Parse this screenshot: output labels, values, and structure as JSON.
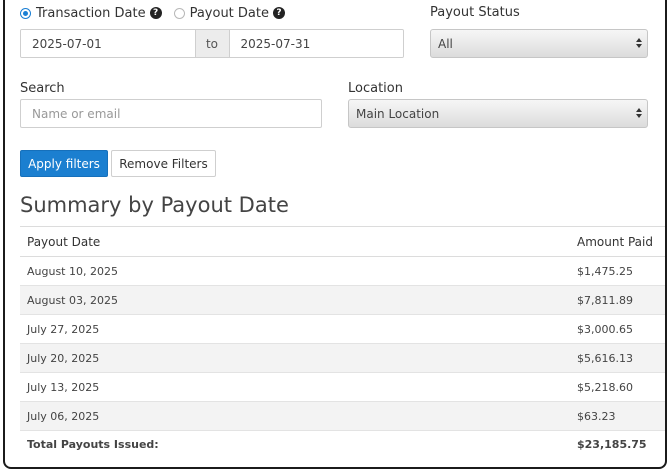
{
  "filters": {
    "date_type_options": [
      {
        "label": "Transaction Date",
        "checked": true
      },
      {
        "label": "Payout Date",
        "checked": false
      }
    ],
    "help_glyph": "?",
    "start_date": "2025-07-01",
    "to_label": "to",
    "end_date": "2025-07-31",
    "payout_status_label": "Payout Status",
    "payout_status_value": "All",
    "search_label": "Search",
    "search_placeholder": "Name or email",
    "location_label": "Location",
    "location_value": "Main Location",
    "apply_label": "Apply filters",
    "remove_label": "Remove Filters"
  },
  "summary": {
    "title": "Summary by Payout Date",
    "columns": [
      "Payout Date",
      "Amount Paid"
    ],
    "rows": [
      {
        "date": "August 10, 2025",
        "amount": "$1,475.25"
      },
      {
        "date": "August 03, 2025",
        "amount": "$7,811.89"
      },
      {
        "date": "July 27, 2025",
        "amount": "$3,000.65"
      },
      {
        "date": "July 20, 2025",
        "amount": "$5,616.13"
      },
      {
        "date": "July 13, 2025",
        "amount": "$5,218.60"
      },
      {
        "date": "July 06, 2025",
        "amount": "$63.23"
      }
    ],
    "total_label": "Total Payouts Issued:",
    "total_amount": "$23,185.75"
  },
  "colors": {
    "accent": "#1b7fd0"
  }
}
